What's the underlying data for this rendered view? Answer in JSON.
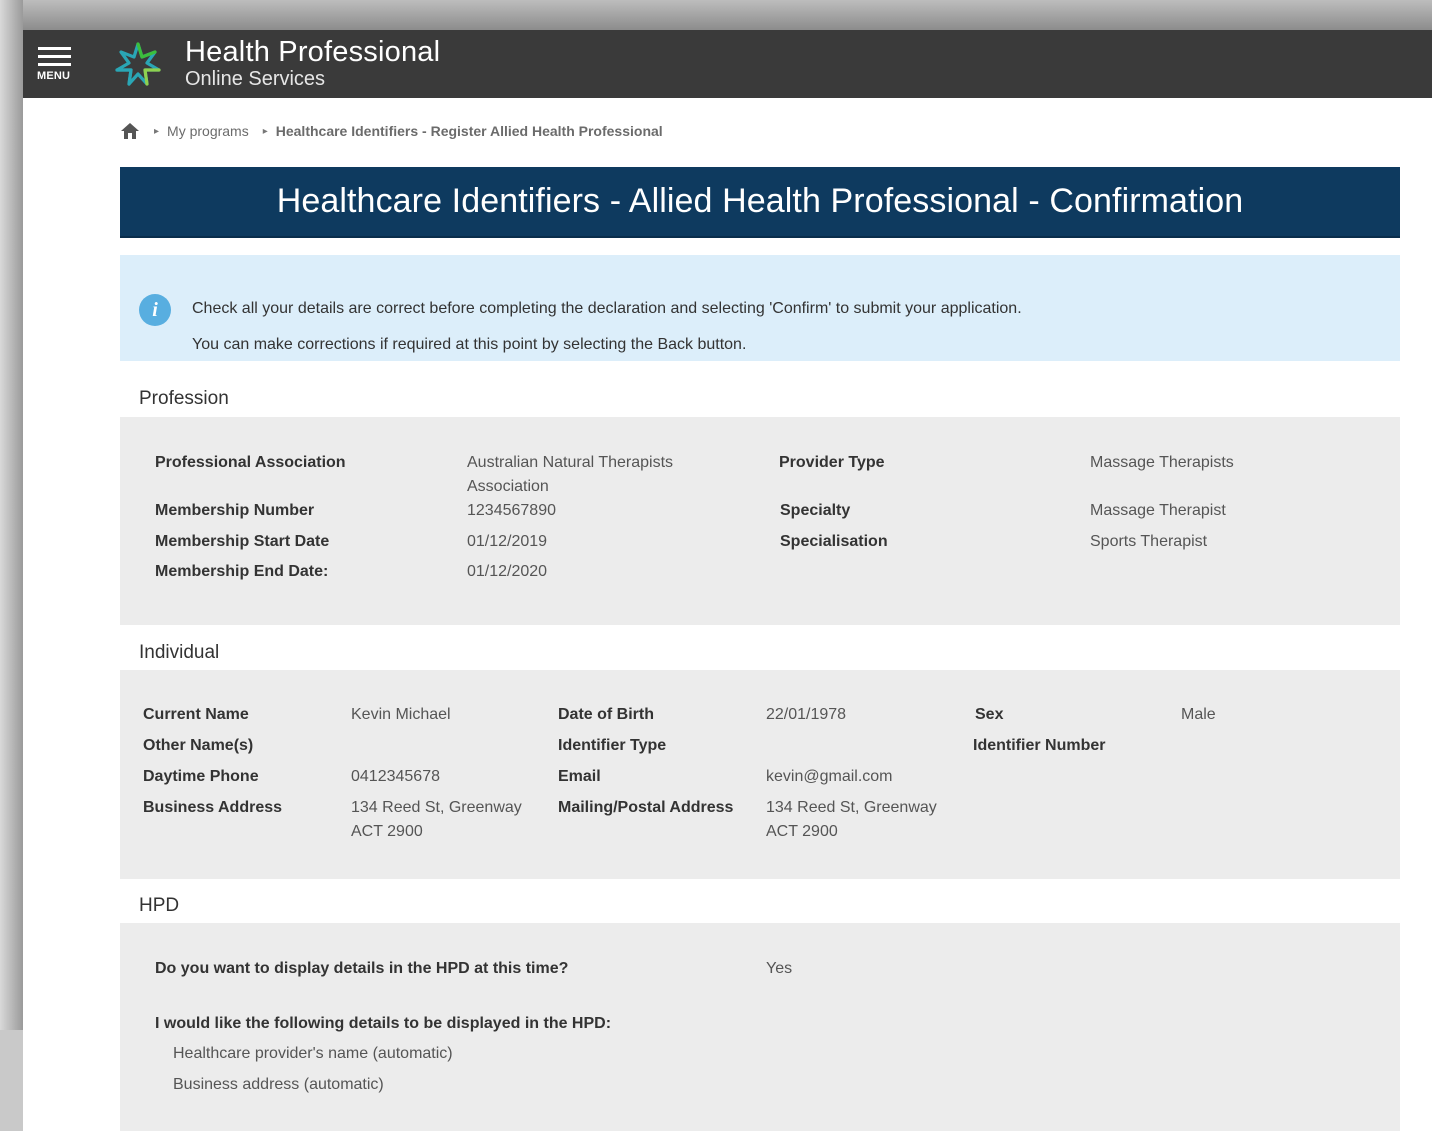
{
  "header": {
    "menu_label": "MENU",
    "brand_title": "Health Professional",
    "brand_subtitle": "Online Services"
  },
  "breadcrumb": {
    "items": [
      {
        "label": "My programs"
      },
      {
        "label": "Healthcare Identifiers - Register Allied Health Professional"
      }
    ]
  },
  "page_title": "Healthcare Identifiers - Allied Health Professional - Confirmation",
  "info": {
    "line1": "Check all your details are correct before completing the declaration and selecting 'Confirm' to submit your application.",
    "line2": "You can make corrections if required at this point by selecting the Back button."
  },
  "profession": {
    "heading": "Profession",
    "left_labels": [
      "Professional Association",
      "Membership Number",
      "Membership Start Date",
      "Membership End Date:"
    ],
    "left_values": [
      "Australian Natural Therapists",
      "Association",
      "1234567890",
      "01/12/2019",
      "01/12/2020"
    ],
    "right_labels": [
      "Provider Type",
      "Specialty",
      "Specialisation"
    ],
    "right_values": [
      "Massage Therapists",
      "Massage Therapist",
      "Sports Therapist"
    ]
  },
  "individual": {
    "heading": "Individual",
    "col1_labels": [
      "Current Name",
      "Other Name(s)",
      "Daytime Phone",
      "Business Address"
    ],
    "col1_values": [
      "Kevin Michael",
      "",
      "0412345678",
      "134 Reed St, Greenway",
      "ACT 2900"
    ],
    "col2_labels": [
      "Date of Birth",
      "Identifier Type",
      "Email",
      "Mailing/Postal Address"
    ],
    "col2_values": [
      "22/01/1978",
      "",
      "kevin@gmail.com",
      "134 Reed St, Greenway",
      "ACT 2900"
    ],
    "col3_labels": [
      "Sex",
      "Identifier Number"
    ],
    "col3_values": [
      "Male"
    ]
  },
  "hpd": {
    "heading": "HPD",
    "question": "Do you want to display details in the HPD at this time?",
    "answer": "Yes",
    "details_heading": "I would like the following details to be displayed in the HPD:",
    "details": [
      "Healthcare provider's name (automatic)",
      "Business address (automatic)"
    ]
  },
  "colors": {
    "topbar": "#3a3a3a",
    "title_band": "#0e3a5f",
    "info_bg": "#dceefa",
    "info_icon": "#58aee0",
    "panel_bg": "#ececec",
    "logo_green": "#3cbf3c",
    "logo_teal": "#2aa6b5"
  },
  "icons": {
    "menu": "hamburger-icon",
    "logo": "star-logo-icon",
    "home": "home-icon",
    "info": "info-icon",
    "separator": "chevron-right-icon"
  }
}
